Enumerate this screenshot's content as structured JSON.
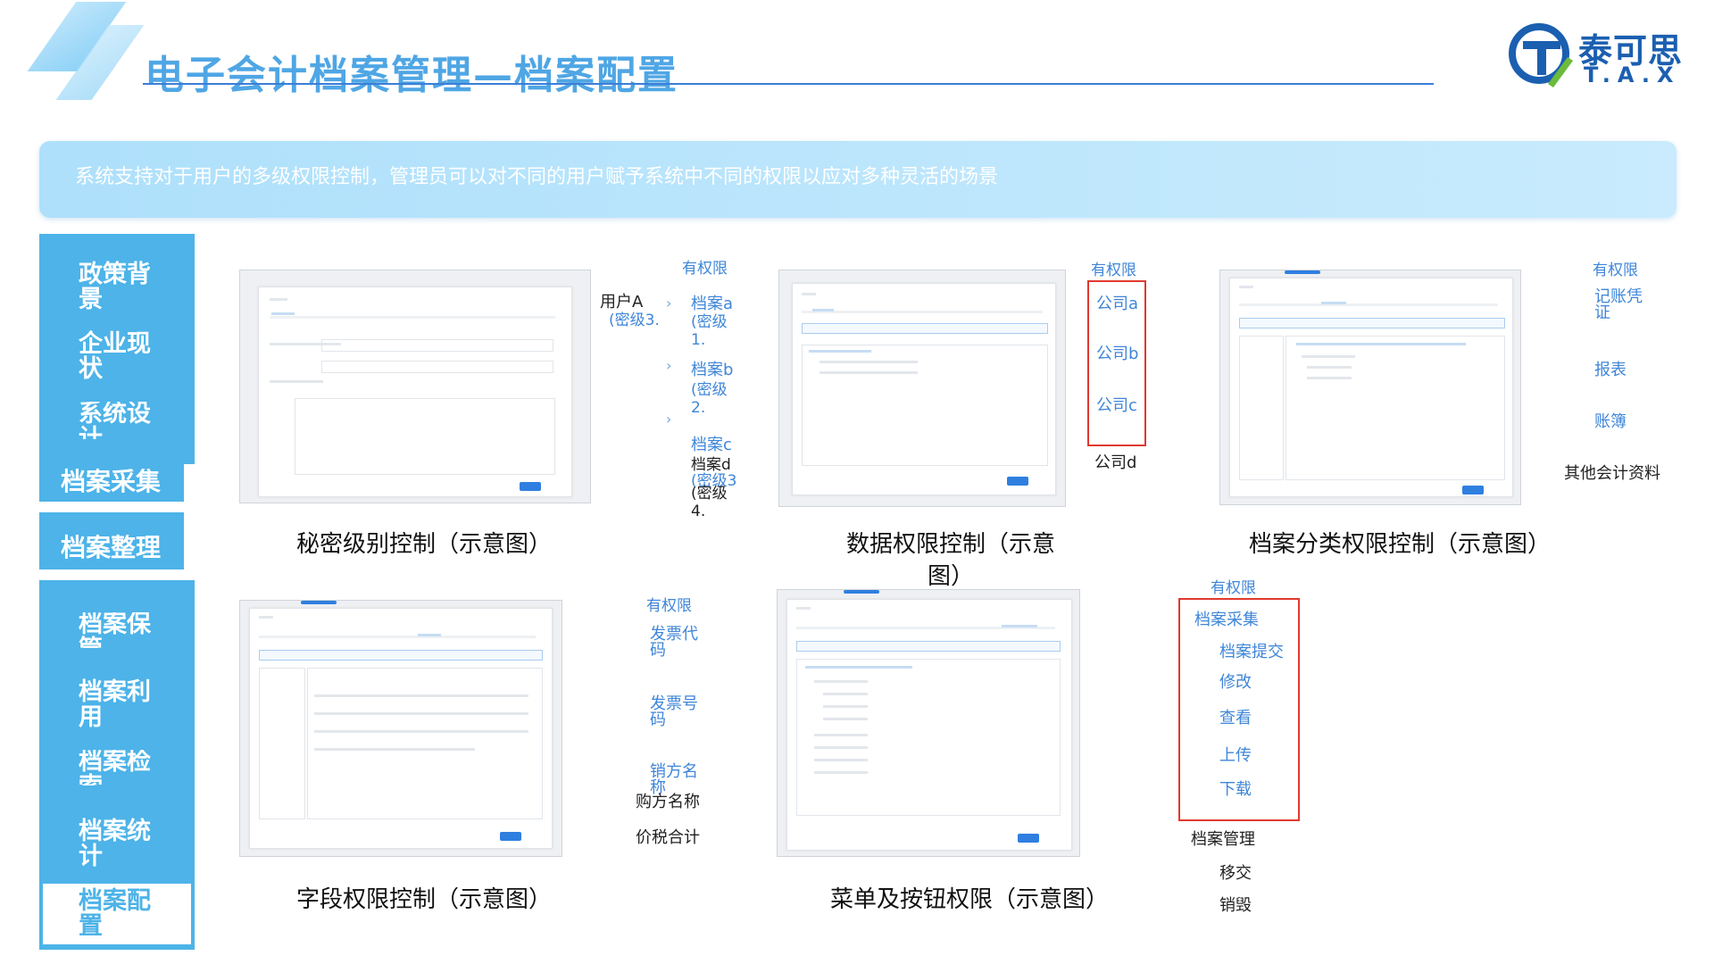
{
  "header": {
    "title": "电子会计档案管理—档案配置",
    "logo_cn": "泰可思",
    "logo_en": "T.A.X"
  },
  "banner": {
    "text": "系统支持对于用户的多级权限控制，管理员可以对不同的用户赋予系统中不同的权限以应对多种灵活的场景"
  },
  "sidebar": {
    "items": [
      "政策背景",
      "企业现状",
      "系统设计",
      "档案采集",
      "档案整理",
      "档案保管",
      "档案利用",
      "档案检索",
      "档案统计",
      "档案配置"
    ],
    "active": "档案配置"
  },
  "secret": {
    "caption": "秘密级别控制（示意图）",
    "user": "用户A",
    "user_level": "(密级3.",
    "has_perm": "有权限",
    "files": [
      "档案a",
      "档案b",
      "档案c"
    ],
    "levels": [
      "(密级1.",
      "(密级2.",
      "(密级3"
    ],
    "file_d": "档案d",
    "level_d": "(密级4."
  },
  "data_perm": {
    "caption": "数据权限控制（示意图）",
    "has_perm": "有权限",
    "allowed": [
      "公司a",
      "公司b",
      "公司c"
    ],
    "other": "公司d"
  },
  "category": {
    "caption": "档案分类权限控制（示意图）",
    "has_perm": "有权限",
    "allowed": [
      "记账凭证",
      "报表",
      "账簿"
    ],
    "other": "其他会计资料"
  },
  "field": {
    "caption": "字段权限控制（示意图）",
    "has_perm": "有权限",
    "allowed": [
      "发票代码",
      "发票号码",
      "销方名称"
    ],
    "others": [
      "购方名称",
      "价税合计"
    ]
  },
  "menu": {
    "caption": "菜单及按钮权限（示意图）",
    "has_perm": "有权限",
    "head": "档案采集",
    "allowed": [
      "档案提交",
      "修改",
      "查看",
      "上传",
      "下载"
    ],
    "other_head": "档案管理",
    "others": [
      "移交",
      "销毁"
    ]
  },
  "colors": {
    "accent": "#4db3e8",
    "title": "#4fa6e4",
    "perm_text": "#3f86d8",
    "highlight_border": "#e0392e"
  }
}
